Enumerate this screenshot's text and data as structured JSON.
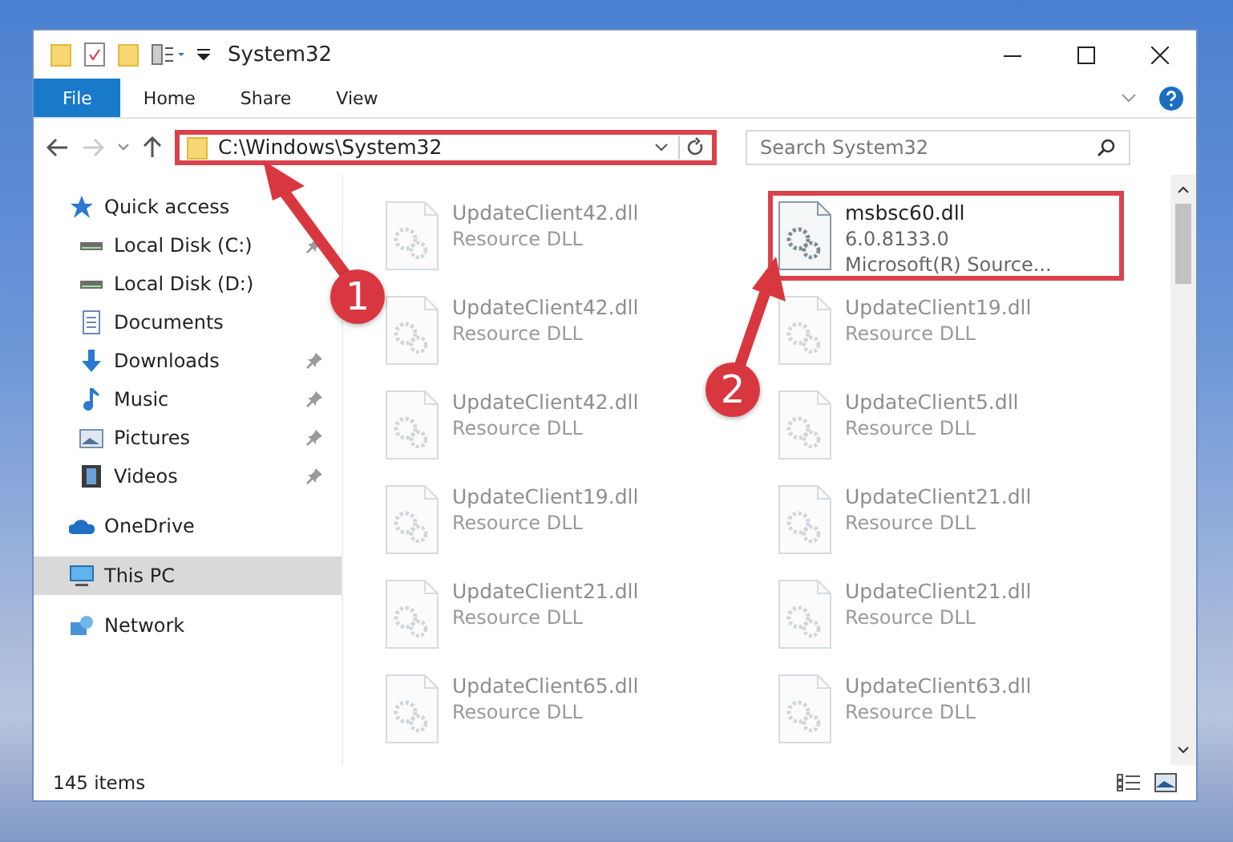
{
  "window": {
    "title": "System32"
  },
  "ribbon_tabs": [
    {
      "label": "File",
      "selected": true
    },
    {
      "label": "Home",
      "selected": false
    },
    {
      "label": "Share",
      "selected": false
    },
    {
      "label": "View",
      "selected": false
    }
  ],
  "address_bar": {
    "path": "C:\\Windows\\System32",
    "highlighted": true
  },
  "search": {
    "placeholder": "Search System32"
  },
  "nav_items": [
    {
      "label": "Quick access",
      "kind": "star",
      "pinned": false,
      "selected": false
    },
    {
      "label": "Local Disk (C:)",
      "kind": "drive",
      "pinned": true,
      "selected": false
    },
    {
      "label": "Local Disk (D:)",
      "kind": "drive",
      "pinned": false,
      "selected": false
    },
    {
      "label": "Documents",
      "kind": "documents",
      "pinned": false,
      "selected": false
    },
    {
      "label": "Downloads",
      "kind": "downloads",
      "pinned": true,
      "selected": false
    },
    {
      "label": "Music",
      "kind": "music",
      "pinned": true,
      "selected": false
    },
    {
      "label": "Pictures",
      "kind": "pictures",
      "pinned": true,
      "selected": false
    },
    {
      "label": "Videos",
      "kind": "videos",
      "pinned": true,
      "selected": false
    },
    {
      "label": "OneDrive",
      "kind": "cloud",
      "pinned": false,
      "selected": false
    },
    {
      "label": "This PC",
      "kind": "computer",
      "pinned": false,
      "selected": true
    },
    {
      "label": "Network",
      "kind": "network",
      "pinned": false,
      "selected": false
    }
  ],
  "files": [
    {
      "name": "UpdateClient42.dll",
      "details": [
        "Resource DLL"
      ],
      "dimmed": true,
      "highlighted": false
    },
    {
      "name": "msbsc60.dll",
      "details": [
        "6.0.8133.0",
        "Microsoft(R) Source..."
      ],
      "dimmed": false,
      "highlighted": true
    },
    {
      "name": "UpdateClient42.dll",
      "details": [
        "Resource DLL"
      ],
      "dimmed": true,
      "highlighted": false
    },
    {
      "name": "UpdateClient19.dll",
      "details": [
        "Resource DLL"
      ],
      "dimmed": true,
      "highlighted": false
    },
    {
      "name": "UpdateClient42.dll",
      "details": [
        "Resource DLL"
      ],
      "dimmed": true,
      "highlighted": false
    },
    {
      "name": "UpdateClient5.dll",
      "details": [
        "Resource DLL"
      ],
      "dimmed": true,
      "highlighted": false
    },
    {
      "name": "UpdateClient19.dll",
      "details": [
        "Resource DLL"
      ],
      "dimmed": true,
      "highlighted": false
    },
    {
      "name": "UpdateClient21.dll",
      "details": [
        "Resource DLL"
      ],
      "dimmed": true,
      "highlighted": false
    },
    {
      "name": "UpdateClient21.dll",
      "details": [
        "Resource DLL"
      ],
      "dimmed": true,
      "highlighted": false
    },
    {
      "name": "UpdateClient21.dll",
      "details": [
        "Resource DLL"
      ],
      "dimmed": true,
      "highlighted": false
    },
    {
      "name": "UpdateClient65.dll",
      "details": [
        "Resource DLL"
      ],
      "dimmed": true,
      "highlighted": false
    },
    {
      "name": "UpdateClient63.dll",
      "details": [
        "Resource DLL"
      ],
      "dimmed": true,
      "highlighted": false
    }
  ],
  "status_bar": {
    "item_count": "145 items"
  },
  "annotations": [
    {
      "label": "1"
    },
    {
      "label": "2"
    }
  ]
}
